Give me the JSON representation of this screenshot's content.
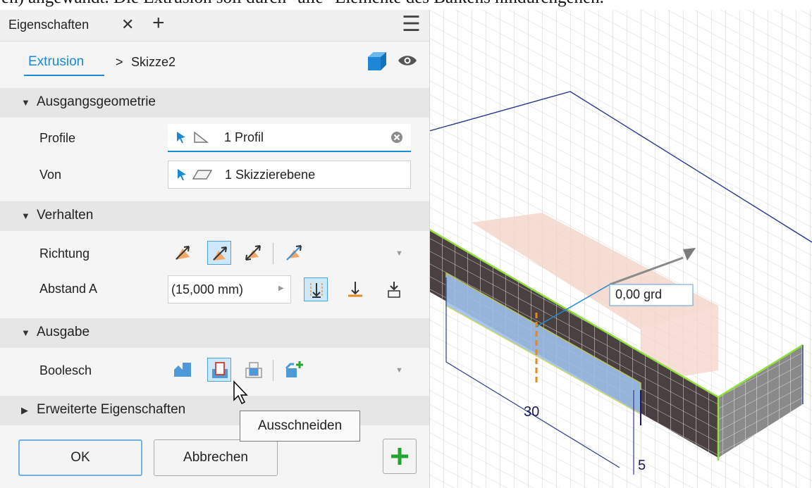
{
  "document": {
    "partial_text": "en) angewandt. Die Extrusion soll durch \"alle\" Elemente des Balkens hindurchgehen."
  },
  "panel": {
    "tab_label": "Eigenschaften",
    "tab_close": "✕",
    "tab_add": "+",
    "menu_icon": "☰",
    "breadcrumb": {
      "feature": "Extrusion",
      "separator": ">",
      "sketch": "Skizze2"
    },
    "sections": {
      "input": {
        "title": "Ausgangsgeometrie",
        "profile": {
          "label": "Profile",
          "value": "1 Profil"
        },
        "from": {
          "label": "Von",
          "value": "1 Skizzierebene"
        }
      },
      "behavior": {
        "title": "Verhalten",
        "direction": {
          "label": "Richtung"
        },
        "distance": {
          "label": "Abstand A",
          "value": "(15,000 mm)"
        }
      },
      "output": {
        "title": "Ausgabe",
        "boolean": {
          "label": "Boolesch"
        }
      },
      "advanced": {
        "title": "Erweiterte Eigenschaften"
      }
    },
    "tooltip": "Ausschneiden",
    "buttons": {
      "ok": "OK",
      "cancel": "Abbrechen",
      "add": "+"
    }
  },
  "viewport": {
    "angle_readout": "0,00 grd",
    "dimension_30": "30",
    "dimension_5": "5"
  },
  "colors": {
    "accent_blue": "#1a8ad4",
    "cut_blue": "#4e9ad8",
    "dimension_orange": "#e8871e",
    "add_green": "#23a52e",
    "edge_green": "#8fe03a"
  }
}
